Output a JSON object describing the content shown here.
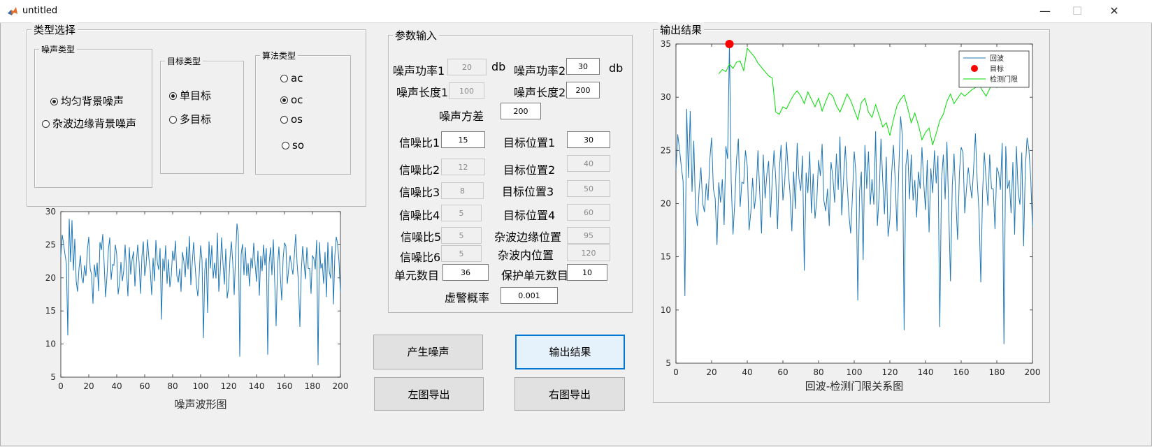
{
  "window": {
    "title": "untitled",
    "minimize": "—",
    "maximize": "☐",
    "close": "✕"
  },
  "type_select": {
    "title": "类型选择",
    "noise_type": {
      "title": "噪声类型",
      "options": [
        "均匀背景噪声",
        "杂波边缘背景噪声"
      ],
      "selected": 0
    },
    "target_type": {
      "title": "目标类型",
      "options": [
        "单目标",
        "多目标"
      ],
      "selected": 0
    },
    "algo_type": {
      "title": "算法类型",
      "options": [
        "ac",
        "oc",
        "os",
        "so"
      ],
      "selected": 1
    }
  },
  "params": {
    "title": "参数输入",
    "noise_power1_label": "噪声功率1",
    "noise_power1": "20",
    "unit1": "db",
    "noise_power2_label": "噪声功率2",
    "noise_power2": "30",
    "unit2": "db",
    "noise_len1_label": "噪声长度1",
    "noise_len1": "100",
    "noise_len2_label": "噪声长度2",
    "noise_len2": "200",
    "noise_var_label": "噪声方差",
    "noise_var": "200",
    "snr1_label": "信噪比1",
    "snr1": "15",
    "target_pos1_label": "目标位置1",
    "target_pos1": "30",
    "snr2_label": "信噪比2",
    "snr2": "12",
    "target_pos2_label": "目标位置2",
    "target_pos2": "40",
    "snr3_label": "信噪比3",
    "snr3": "8",
    "target_pos3_label": "目标位置3",
    "target_pos3": "50",
    "snr4_label": "信噪比4",
    "snr4": "5",
    "target_pos4_label": "目标位置4",
    "target_pos4": "60",
    "snr5_label": "信噪比5",
    "snr5": "5",
    "clutter_edge_label": "杂波边缘位置",
    "clutter_edge": "95",
    "snr6_label": "信噪比6",
    "snr6": "5",
    "clutter_inner_label": "杂波内位置",
    "clutter_inner": "120",
    "cell_count_label": "单元数目",
    "cell_count": "36",
    "guard_count_label": "保护单元数目",
    "guard_count": "10",
    "pfa_label": "虚警概率",
    "pfa": "0.001"
  },
  "buttons": {
    "gen_noise": "产生噪声",
    "output_result": "输出结果",
    "export_left": "左图导出",
    "export_right": "右图导出"
  },
  "output_panel": {
    "title": "输出结果"
  },
  "colors": {
    "echo": "#1f77b4",
    "target": "#ff0000",
    "threshold": "#00dd00"
  },
  "chart_data": [
    {
      "type": "line",
      "xlabel": "噪声波形图",
      "ylabel": "",
      "xlim": [
        0,
        200
      ],
      "ylim": [
        5,
        30
      ],
      "xticks": [
        0,
        20,
        40,
        60,
        80,
        100,
        120,
        140,
        160,
        180,
        200
      ],
      "yticks": [
        5,
        10,
        15,
        20,
        25,
        30
      ],
      "series": [
        {
          "values": [
            23.2,
            26.5,
            25.1,
            23.5,
            22.1,
            11.3,
            28.9,
            22.4,
            28.7,
            21.1,
            25.9,
            19.5,
            17.9,
            21.4,
            23.4,
            20.0,
            19.2,
            21.9,
            20.3,
            24.2,
            26.2,
            21.4,
            20.5,
            16.1,
            22.0,
            20.1,
            22.3,
            18.0,
            25.4,
            24.2,
            26.6,
            22.1,
            17.1,
            20.2,
            24.2,
            26.1,
            19.7,
            22.0,
            21.9,
            25.0,
            23.5,
            17.5,
            19.2,
            22.4,
            19.5,
            21.1,
            25.0,
            21.1,
            17.2,
            24.6,
            20.5,
            22.8,
            24.0,
            18.7,
            22.1,
            25.0,
            22.3,
            17.6,
            23.2,
            25.5,
            20.3,
            21.9,
            25.8,
            23.0,
            21.0,
            17.4,
            23.0,
            19.5,
            25.7,
            22.4,
            21.2,
            24.5,
            13.7,
            22.9,
            21.0,
            24.9,
            19.1,
            22.8,
            18.6,
            20.3,
            24.1,
            22.6,
            25.6,
            20.3,
            19.3,
            21.4,
            17.9,
            23.9,
            22.5,
            20.1,
            24.7,
            21.3,
            26.3,
            18.9,
            22.2,
            25.4,
            22.0,
            19.0,
            17.2,
            20.6,
            24.9,
            22.7,
            10.9,
            21.2,
            23.0,
            14.7,
            25.5,
            21.4,
            24.9,
            19.9,
            22.3,
            19.9,
            26.8,
            17.9,
            20.8,
            26.1,
            22.2,
            19.0,
            24.4,
            16.9,
            18.5,
            22.9,
            25.5,
            22.3,
            17.4,
            23.2,
            28.2,
            26.4,
            8.1,
            23.6,
            25.1,
            20.4,
            24.6,
            20.3,
            22.2,
            18.7,
            23.0,
            21.4,
            25.3,
            22.0,
            19.4,
            24.1,
            17.3,
            23.3,
            21.0,
            25.0,
            21.9,
            24.5,
            8.4,
            22.2,
            24.6,
            20.4,
            25.8,
            19.4,
            12.7,
            21.7,
            24.7,
            20.3,
            16.6,
            22.9,
            25.3,
            24.8,
            19.1,
            21.4,
            23.4,
            21.8,
            20.5,
            23.3,
            26.6,
            22.2,
            19.3,
            12.6,
            21.0,
            24.8,
            22.2,
            19.8,
            24.6,
            21.4,
            21.4,
            17.6,
            23.4,
            22.9,
            21.3,
            25.7,
            6.8,
            25.4,
            21.4,
            22.2,
            19.1,
            23.9,
            17.1,
            25.4,
            21.0,
            19.9,
            24.8,
            16.0,
            23.3,
            26.2,
            25.1,
            22.4,
            17.8
          ]
        }
      ]
    },
    {
      "type": "line",
      "xlabel": "回波-检测门限关系图",
      "ylabel": "",
      "xlim": [
        0,
        200
      ],
      "ylim": [
        5,
        35
      ],
      "xticks": [
        0,
        20,
        40,
        60,
        80,
        100,
        120,
        140,
        160,
        180,
        200
      ],
      "yticks": [
        5,
        10,
        15,
        20,
        25,
        30,
        35
      ],
      "legend": {
        "position": "top-right",
        "entries": [
          "回波",
          "目标",
          "检测门限"
        ]
      },
      "series": [
        {
          "name": "回波",
          "x_start": 0,
          "x_step": 1,
          "values": [
            23.2,
            26.5,
            25.1,
            23.5,
            22.1,
            11.3,
            28.9,
            22.4,
            28.7,
            21.1,
            25.9,
            19.5,
            17.9,
            21.4,
            23.4,
            20.0,
            19.2,
            21.9,
            20.3,
            24.2,
            26.2,
            21.4,
            20.5,
            16.1,
            22.0,
            20.1,
            22.3,
            18.0,
            25.4,
            24.2,
            35.0,
            22.1,
            17.1,
            20.2,
            24.2,
            26.1,
            19.7,
            22.0,
            21.9,
            25.0,
            23.5,
            17.5,
            19.2,
            22.4,
            19.5,
            21.1,
            25.0,
            21.1,
            17.2,
            24.6,
            20.5,
            22.8,
            24.0,
            18.7,
            22.1,
            25.0,
            22.3,
            17.6,
            23.2,
            25.5,
            20.3,
            21.9,
            25.8,
            23.0,
            21.0,
            17.4,
            23.0,
            19.5,
            25.7,
            22.4,
            21.2,
            24.5,
            13.7,
            22.9,
            21.0,
            24.9,
            19.1,
            22.8,
            18.6,
            20.3,
            24.1,
            22.6,
            25.6,
            20.3,
            19.3,
            21.4,
            17.9,
            23.9,
            22.5,
            20.1,
            24.7,
            21.3,
            26.3,
            18.9,
            22.2,
            25.4,
            22.0,
            19.0,
            17.2,
            20.6,
            24.9,
            22.7,
            10.9,
            21.2,
            23.0,
            14.7,
            25.5,
            21.4,
            24.9,
            19.9,
            22.3,
            19.9,
            26.8,
            17.9,
            20.8,
            26.1,
            22.2,
            19.0,
            24.4,
            16.9,
            18.5,
            22.9,
            25.5,
            22.3,
            17.4,
            23.2,
            28.2,
            26.4,
            8.1,
            23.6,
            25.1,
            20.4,
            24.6,
            20.3,
            22.2,
            18.7,
            23.0,
            21.4,
            25.3,
            22.0,
            19.4,
            24.1,
            17.3,
            23.3,
            21.0,
            25.0,
            21.9,
            24.5,
            8.4,
            22.2,
            24.6,
            20.4,
            25.8,
            19.4,
            12.7,
            21.7,
            24.7,
            20.3,
            16.6,
            22.9,
            25.3,
            24.8,
            19.1,
            21.4,
            23.4,
            21.8,
            20.5,
            23.3,
            26.6,
            22.2,
            19.3,
            12.6,
            21.0,
            24.8,
            22.2,
            19.8,
            24.6,
            21.4,
            21.4,
            17.6,
            23.4,
            22.9,
            21.3,
            25.7,
            6.8,
            25.4,
            21.4,
            22.2,
            19.1,
            23.9,
            17.1,
            25.4,
            21.0,
            19.9,
            24.8,
            16.0,
            23.3,
            26.2,
            25.1,
            22.4,
            17.8
          ]
        },
        {
          "name": "目标",
          "points": [
            [
              30,
              35.0
            ]
          ]
        },
        {
          "name": "检测门限",
          "x_start": 24,
          "x_step": 2,
          "values": [
            32.2,
            32.6,
            32.4,
            33.1,
            32.7,
            33.3,
            33.4,
            32.5,
            34.6,
            34.2,
            33.8,
            33.2,
            32.8,
            32.4,
            32.0,
            31.8,
            28.6,
            28.4,
            29.1,
            28.9,
            29.6,
            30.2,
            30.6,
            30.1,
            29.4,
            30.5,
            29.8,
            29.1,
            29.9,
            28.7,
            29.6,
            30.4,
            30.1,
            29.2,
            28.6,
            29.4,
            30.3,
            29.7,
            28.8,
            27.9,
            29.5,
            29.9,
            28.6,
            28.1,
            29.3,
            28.3,
            27.2,
            27.6,
            26.4,
            27.9,
            29.2,
            29.8,
            30.2,
            29.0,
            27.6,
            28.5,
            27.4,
            26.0,
            26.7,
            27.1,
            25.5,
            26.6,
            27.8,
            28.4,
            29.6,
            30.3,
            29.4,
            29.9,
            30.4,
            30.1,
            30.4,
            30.7,
            30.9,
            31.2,
            30.6,
            30.1,
            30.8,
            31.5,
            30.9,
            31.3,
            30.9
          ]
        }
      ]
    }
  ]
}
